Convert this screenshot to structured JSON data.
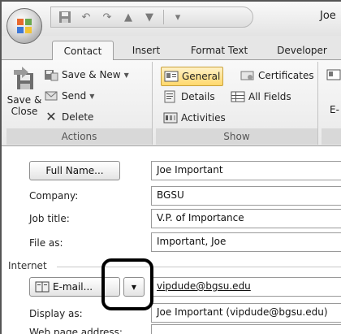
{
  "window": {
    "title": "Joe"
  },
  "tabs": [
    {
      "label": "Contact",
      "active": true
    },
    {
      "label": "Insert",
      "active": false
    },
    {
      "label": "Format Text",
      "active": false
    },
    {
      "label": "Developer",
      "active": false
    }
  ],
  "ribbon": {
    "actions": {
      "label": "Actions",
      "save_close": "Save & Close",
      "save_new": "Save & New",
      "send": "Send",
      "delete": "Delete"
    },
    "show": {
      "label": "Show",
      "general": "General",
      "details": "Details",
      "activities": "Activities",
      "certificates": "Certificates",
      "all_fields": "All Fields"
    },
    "partial_next_group": "E-"
  },
  "form": {
    "full_name_button": "Full Name...",
    "full_name_value": "Joe Important",
    "company_label": "Company:",
    "company_value": "BGSU",
    "job_title_label": "Job title:",
    "job_title_value": "V.P. of Importance",
    "file_as_label": "File as:",
    "file_as_value": "Important, Joe",
    "internet_section": "Internet",
    "email_button": "E-mail...",
    "email_value": "vipdude@bgsu.edu",
    "display_as_label": "Display as:",
    "display_as_value": "Joe Important (vipdude@bgsu.edu)",
    "web_page_label": "Web page address:"
  },
  "colors": {
    "selected_button_top": "#fff1c7",
    "selected_button_bottom": "#ffd86b",
    "highlight_box": "#000000"
  },
  "icons": [
    "office-logo-icon",
    "save-icon",
    "undo-icon",
    "redo-icon",
    "up-arrow-icon",
    "down-arrow-icon",
    "save-close-icon",
    "save-new-icon",
    "send-icon",
    "delete-icon",
    "general-icon",
    "details-icon",
    "activities-icon",
    "certificates-icon",
    "all-fields-icon",
    "address-book-icon",
    "dropdown-arrow-icon"
  ]
}
